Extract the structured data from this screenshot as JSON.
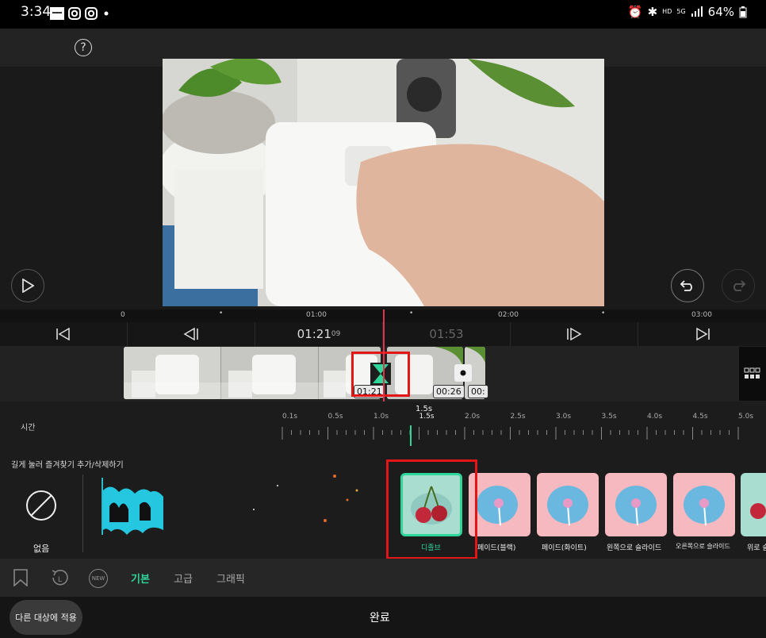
{
  "status_bar": {
    "time": "3:34",
    "battery": "64%",
    "signal_label": "5G",
    "hd_label": "HD"
  },
  "editor": {
    "timeline_ruler": [
      "0",
      "01:00",
      "02:00",
      "03:00"
    ],
    "current_time": "01:21",
    "current_frame": "09",
    "total_time": "01:53",
    "clip_times": [
      "01:21",
      "00:26",
      "00:"
    ]
  },
  "duration": {
    "label": "시간",
    "selected": "1.5s",
    "ticks": [
      "0.1s",
      "0.5s",
      "1.0s",
      "1.5s",
      "2.0s",
      "2.5s",
      "3.0s",
      "3.5s",
      "4.0s",
      "4.5s",
      "5.0s"
    ]
  },
  "transitions": {
    "hint": "길게 눌러 즐겨찾기 추가/삭제하기",
    "none_label": "없음",
    "items": [
      "디졸브",
      "페이드(블랙)",
      "페이드(화이트)",
      "왼쪽으로 슬라이드",
      "오른쪽으로 슬라이드",
      "위로 슬"
    ]
  },
  "tabs": {
    "new_label": "NEW",
    "basic": "기본",
    "advanced": "고급",
    "graphic": "그래픽"
  },
  "footer": {
    "apply_label": "다른 대상에 적용",
    "done_label": "완료"
  },
  "colors": {
    "accent": "#2fd69a",
    "playhead": "#e0334d",
    "highlight": "#e41515"
  }
}
